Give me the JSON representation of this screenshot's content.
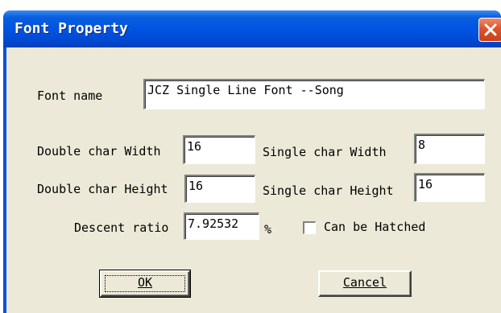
{
  "window": {
    "title": "Font Property"
  },
  "form": {
    "font_name_label": "Font name",
    "font_name_value": "JCZ Single Line Font --Song",
    "double_width_label": "Double char Width",
    "double_width_value": "16",
    "single_width_label": "Single char Width",
    "single_width_value": "8",
    "double_height_label": "Double char Height",
    "double_height_value": "16",
    "single_height_label": "Single char Height",
    "single_height_value": "16",
    "descent_label": "Descent ratio",
    "descent_value": "7.92532",
    "percent_label": "%",
    "hatched_label": "Can be Hatched",
    "hatched_checked": false
  },
  "buttons": {
    "ok": "OK",
    "cancel": "Cancel"
  },
  "icons": {
    "close": "close-icon"
  }
}
